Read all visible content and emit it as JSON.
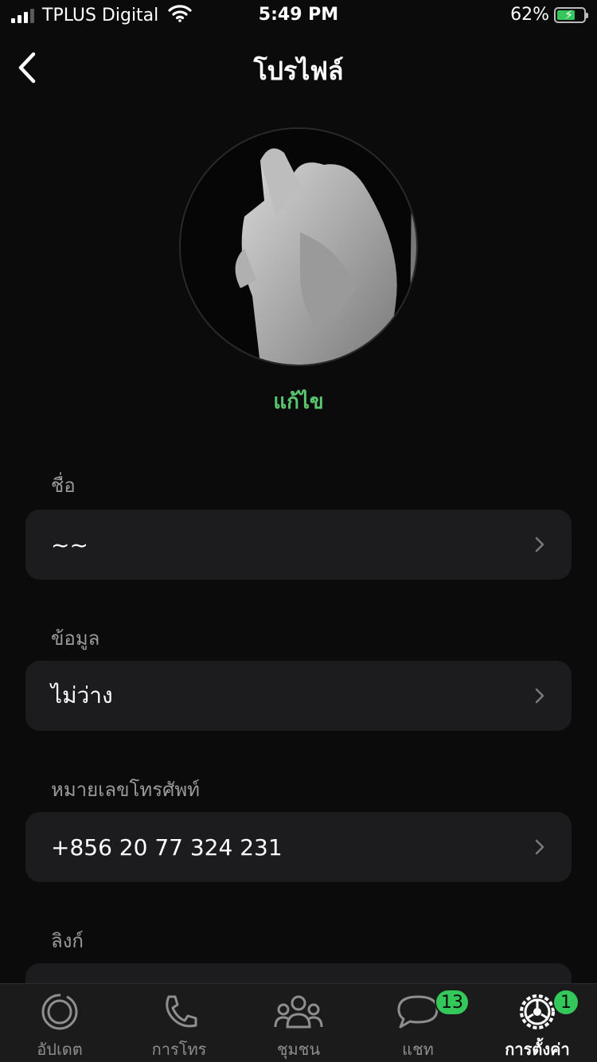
{
  "status_bar": {
    "carrier": "TPLUS Digital",
    "time": "5:49 PM",
    "battery_percent": "62%",
    "battery_level": 0.62
  },
  "nav": {
    "title": "โปรไฟล์",
    "back_icon": "chevron-left-icon"
  },
  "profile": {
    "edit_label": "แก้ไข",
    "accent_color": "#5ac46f"
  },
  "sections": [
    {
      "label": "ชื่อ",
      "value": "~~"
    },
    {
      "label": "ข้อมูล",
      "value": "ไม่ว่าง"
    },
    {
      "label": "หมายเลขโทรศัพท์",
      "value": "+856 20 77 324 231"
    },
    {
      "label": "ลิงก์",
      "value": ""
    }
  ],
  "tabbar": {
    "tabs": [
      {
        "label": "อัปเดต",
        "icon": "status-icon",
        "badge": ""
      },
      {
        "label": "การโทร",
        "icon": "phone-icon",
        "badge": ""
      },
      {
        "label": "ชุมชน",
        "icon": "community-icon",
        "badge": ""
      },
      {
        "label": "แชท",
        "icon": "chat-icon",
        "badge": "13"
      },
      {
        "label": "การตั้งค่า",
        "icon": "settings-icon",
        "badge": "1",
        "active": true
      }
    ]
  }
}
